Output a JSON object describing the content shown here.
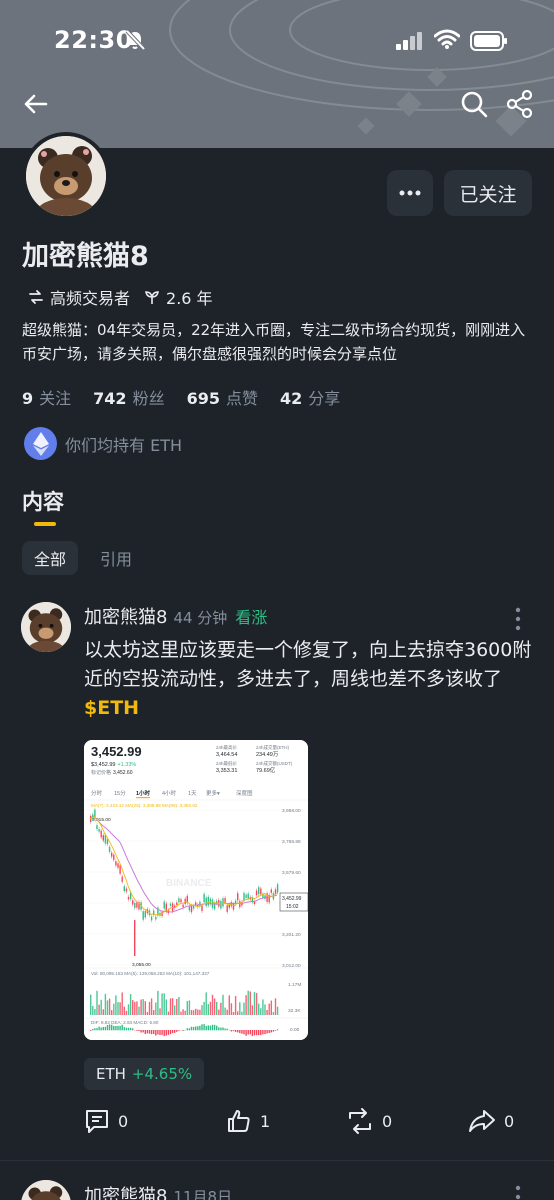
{
  "status_bar": {
    "time": "22:30"
  },
  "header": {
    "follow_label": "已关注"
  },
  "profile": {
    "name": "加密熊猫8",
    "tag_trader": "高频交易者",
    "tag_years": "2.6 年",
    "bio": "超级熊猫：04年交易员，22年进入币圈，专注二级市场合约现货，刚刚进入币安广场，请多关照，偶尔盘感很强烈的时候会分享点位",
    "stats": [
      {
        "value": "9",
        "label": "关注"
      },
      {
        "value": "742",
        "label": "粉丝"
      },
      {
        "value": "695",
        "label": "点赞"
      },
      {
        "value": "42",
        "label": "分享"
      }
    ],
    "holding_text": "你们均持有 ETH"
  },
  "tabs": {
    "content": "内容"
  },
  "filters": {
    "all": "全部",
    "quote": "引用"
  },
  "post": {
    "author": "加密熊猫8",
    "time": "44 分钟",
    "sentiment": "看涨",
    "text": "以太坊这里应该要走一个修复了，向上去掠夺3600附近的空投流动性，多进去了，周线也差不多该收了",
    "ticker": "$ETH",
    "pill_symbol": "ETH",
    "pill_change": "+4.65%",
    "comments": "0",
    "likes": "1",
    "reposts": "0",
    "shares": "0",
    "chart": {
      "price": "3,452.99",
      "sub_price": "$3,452.99",
      "sub_change": "+1.33%",
      "mark_label": "标记价格",
      "mark_value": "3,452.60",
      "high_label": "24h最高价",
      "high_value": "3,464.54",
      "vol_eth_label": "24h成交量(ETH)",
      "vol_eth_value": "234.49万",
      "low_label": "24h最低价",
      "low_value": "3,353.31",
      "vol_usdt_label": "24h成交额(USDT)",
      "vol_usdt_value": "79.69亿",
      "intervals": [
        "分时",
        "15分",
        "1小时",
        "4小时",
        "1天",
        "更多▾",
        "深度图"
      ],
      "ma_line": "MA(7): 3,423.12   MA(25): 3,399.88   MA(99): 3,383.62",
      "y_ticks": [
        "3,958.00",
        "3,768.88",
        "3,579.60",
        "3,390.32",
        "3,201.20",
        "3,012.00"
      ],
      "high_mark": "3,915.00",
      "low_mark": "3,055.00",
      "last_price": "3,452.99",
      "countdown": "15:02",
      "watermark": "BINANCE",
      "vol_line": "Vol: 80,095.153   MA(5): 129,058.253   MA(10): 101,147.337",
      "vol_ticks": [
        "1.17M",
        "32.3K"
      ],
      "macd_line": "DIF: 8.82   DEA: 2.93   MACD: 5.90",
      "macd_tick": "0.00"
    }
  },
  "post2": {
    "author": "加密熊猫8",
    "time": "11月8日"
  }
}
